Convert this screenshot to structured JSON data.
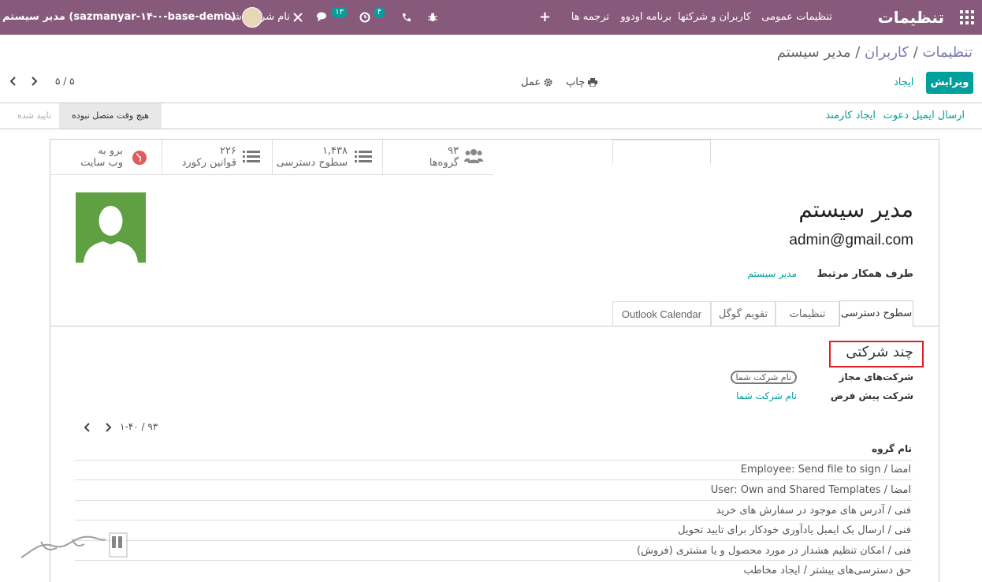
{
  "navbar": {
    "app_title": "تنظیمات",
    "menu": [
      "تنظیمات عمومی",
      "کاربران و شرکتها",
      "برنامه اودوو",
      "ترجمه ها"
    ],
    "plus": "+",
    "activity_count": "۴",
    "messages_count": "۱۳",
    "company_name": "نام شرکت شما",
    "user_name": "مدیر سیستم (sazmanyar-۱۴-۰-base-demo)"
  },
  "breadcrumb": {
    "root": "تنظیمات",
    "parent": "کاربران",
    "current": "مدیر سیستم",
    "sep": "/"
  },
  "actions": {
    "edit": "ویرایش",
    "create": "ایجاد",
    "print": "چاپ",
    "action": "عمل"
  },
  "pager": {
    "value": "۵ / ۵"
  },
  "header_buttons": {
    "invite": "ارسال ایمیل دعوت",
    "employee": "ایجاد کارمند"
  },
  "status": {
    "never_connected": "هیچ وقت متصل نبوده",
    "confirmed": "تایید شده"
  },
  "smart_buttons": [
    {
      "num": "۹۳",
      "label": "گروه‌ها"
    },
    {
      "num": "۱,۴۳۸",
      "label": "سطوح دسترسی"
    },
    {
      "num": "۲۲۶",
      "label": "قوانین رکورد"
    },
    {
      "num": "برو به",
      "label": "وب سایت"
    }
  ],
  "user": {
    "name": "مدیر سیستم",
    "login": "admin@gmail.com"
  },
  "partner": {
    "label": "طرف همکار مرتبط",
    "value": "مدیر سیستم"
  },
  "tabs": [
    "سطوح دسترسی",
    "تنظیمات",
    "تقویم گوگل",
    "Outlook Calendar"
  ],
  "multi_company": {
    "title": "چند شرکتی",
    "allowed_label": "شرکت‌های مجاز",
    "allowed_value": "نام شرکت شما",
    "default_label": "شرکت پیش فرض",
    "default_value": "نام شرکت شما"
  },
  "groups_pager": "۱-۴۰ / ۹۳",
  "groups": {
    "header": "نام گروه",
    "rows": [
      "امضا / Employee: Send file to sign",
      "امضا / User: Own and Shared Templates",
      "فنی / آدرس های موجود در سفارش های خرید",
      "فنی / ارسال یک ایمیل یادآوری خودکار برای تایید تحویل",
      "فنی / امکان تنظیم هشدار در مورد محصول و یا مشتری (فروش)",
      "حق دسترسی‌های بیشتر / ایجاد مخاطب"
    ]
  },
  "colors": {
    "brand": "#875a7b",
    "accent": "#00a09d",
    "highlight": "#e02020"
  }
}
